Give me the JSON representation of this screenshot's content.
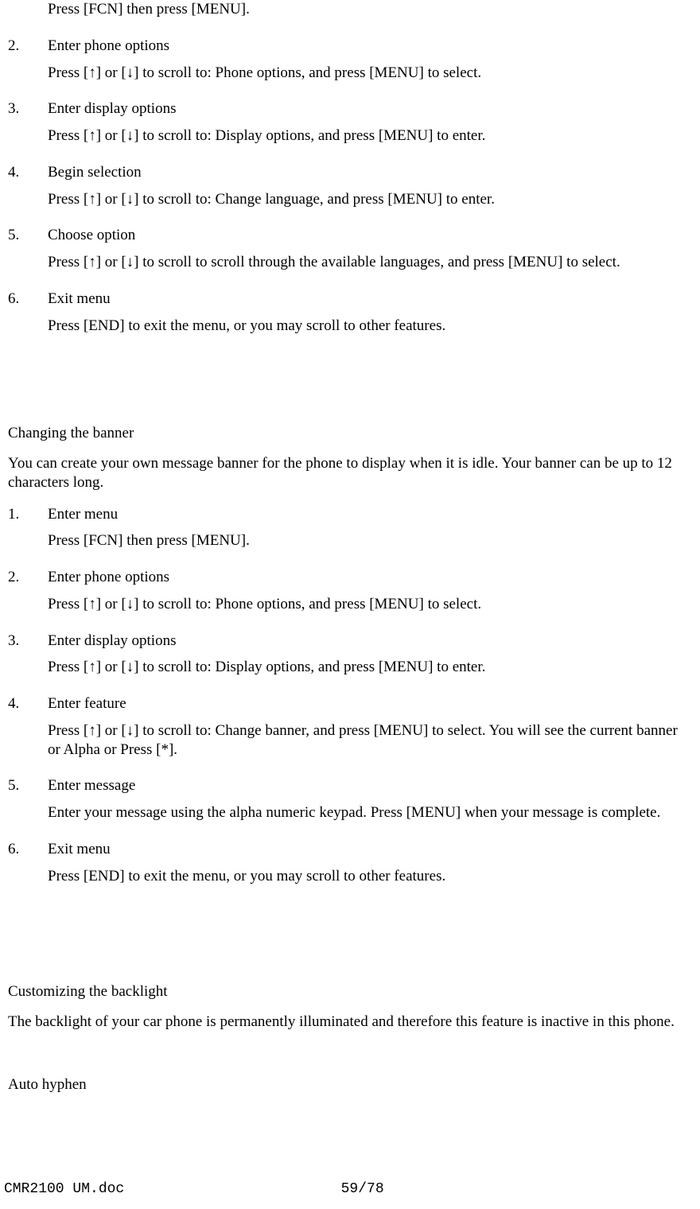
{
  "intro_detail": "Press [FCN] then press [MENU].",
  "listA": [
    {
      "num": "2.",
      "title": "Enter phone options",
      "detail": "Press [↑] or [↓] to scroll to: Phone options, and press [MENU] to select."
    },
    {
      "num": "3.",
      "title": "Enter display options",
      "detail": "Press [↑] or [↓] to scroll to: Display options, and press [MENU] to enter."
    },
    {
      "num": "4.",
      "title": "Begin selection",
      "detail": "Press [↑] or [↓] to scroll to: Change language, and press [MENU] to enter."
    },
    {
      "num": "5.",
      "title": "Choose option",
      "detail": "Press [↑] or [↓] to scroll to scroll through the available languages, and press [MENU] to select."
    },
    {
      "num": "6.",
      "title": "Exit menu",
      "detail": "Press [END] to exit the menu, or you may scroll to other features."
    }
  ],
  "sectionB": {
    "heading": "Changing the banner",
    "text": "You can create your own message banner for the phone to display when it is idle. Your banner can be up to 12 characters long.",
    "steps": [
      {
        "num": "1.",
        "title": "Enter menu",
        "detail": "Press [FCN] then press [MENU]."
      },
      {
        "num": "2.",
        "title": "Enter phone options",
        "detail": "Press [↑] or [↓] to scroll to: Phone options, and press [MENU] to select."
      },
      {
        "num": "3.",
        "title": "Enter display options",
        "detail": "Press [↑] or [↓] to scroll to: Display options, and press [MENU] to enter."
      },
      {
        "num": "4.",
        "title": "Enter feature",
        "detail": "Press [↑] or [↓] to scroll to: Change banner, and press [MENU] to select. You will see the current banner or Alpha or Press [*]."
      },
      {
        "num": "5.",
        "title": "Enter message",
        "detail": "Enter your message using the alpha numeric keypad. Press [MENU] when your message is complete."
      },
      {
        "num": "6.",
        "title": "Exit menu",
        "detail": "Press [END] to exit the menu, or you may scroll to other features."
      }
    ]
  },
  "sectionC": {
    "heading": "Customizing the backlight",
    "text": "The backlight of your car phone is permanently illuminated and therefore this feature is inactive in this phone."
  },
  "sectionD": {
    "heading": "Auto hyphen"
  },
  "footer": {
    "docname": "CMR2100 UM.doc",
    "page": "59/78"
  }
}
